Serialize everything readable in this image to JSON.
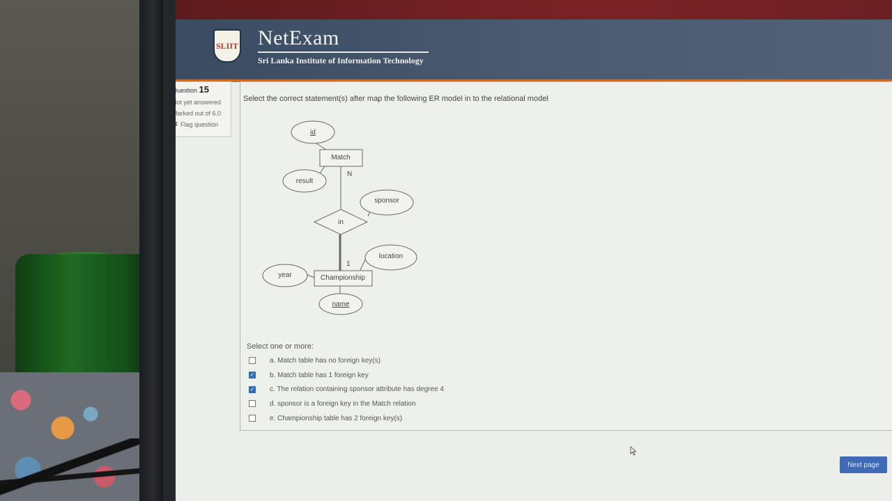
{
  "brand": {
    "logo_text": "SLIIT",
    "title": "NetExam",
    "subtitle": "Sri Lanka Institute of Information Technology"
  },
  "question_info": {
    "label": "Question",
    "number": "15",
    "status": "Not yet answered",
    "marks": "Marked out of 6.0",
    "flag_label": "Flag question"
  },
  "question": {
    "text": "Select the correct statement(s) after map the following ER model in to the relational model",
    "prompt": "Select one or more:",
    "answers": [
      {
        "label": "a. Match table has no foreign key(s)",
        "checked": false
      },
      {
        "label": "b. Match table has 1 foreign key",
        "checked": true
      },
      {
        "label": "c. The relation containing sponsor attribute has degree 4",
        "checked": true
      },
      {
        "label": "d. sponsor is a foreign key in the Match relation",
        "checked": false
      },
      {
        "label": "e. Championship table has 2 foreign key(s)",
        "checked": false
      }
    ]
  },
  "er_diagram": {
    "entities": [
      "Match",
      "Championship"
    ],
    "relationship": "in",
    "attributes": [
      "id",
      "result",
      "sponsor",
      "location",
      "year",
      "name"
    ],
    "cardinality_match": "N",
    "cardinality_championship": "1"
  },
  "navigation": {
    "next_label": "Next page"
  },
  "colors": {
    "header_bar": "#7a2326",
    "banner": "#4a5a70",
    "banner_accent": "#c96b2d",
    "next_button": "#3e6ab8",
    "checkbox_checked": "#2c6fb8"
  }
}
